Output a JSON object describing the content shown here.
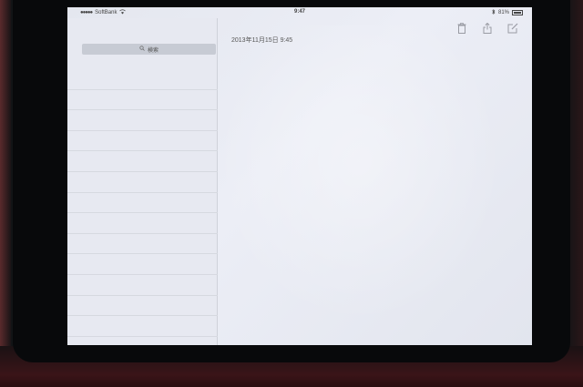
{
  "status_bar": {
    "signal_dots": "●●●●●",
    "carrier": "SoftBank",
    "time": "9:47",
    "battery_percent": "81%"
  },
  "search": {
    "label": "検索"
  },
  "note": {
    "date": "2013年11月15日 9:45"
  },
  "icons": {
    "wifi": "wifi-icon",
    "bluetooth": "bluetooth-icon",
    "battery": "battery-icon",
    "search": "search-icon",
    "trash": "trash-icon",
    "share": "share-icon",
    "compose": "compose-icon"
  },
  "colors": {
    "screen_bg": "#e4e7ef",
    "sidebar_bg": "#e7e9f1",
    "search_bg": "#c7cbd4",
    "divider": "#d6d9e0"
  }
}
